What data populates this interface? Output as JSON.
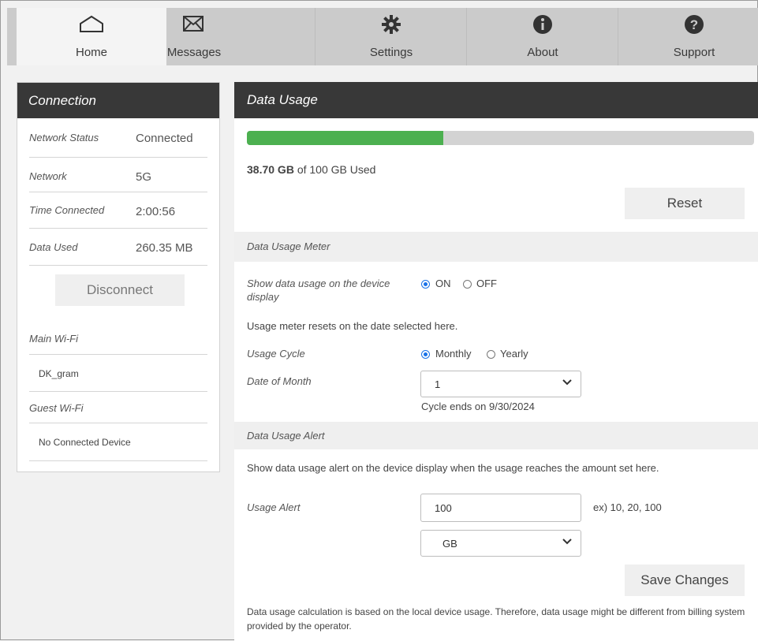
{
  "tabs": [
    {
      "label": "Home",
      "icon": "home-icon"
    },
    {
      "label": "Messages",
      "icon": "envelope-icon"
    },
    {
      "label": "Settings",
      "icon": "gear-icon"
    },
    {
      "label": "About",
      "icon": "info-icon"
    },
    {
      "label": "Support",
      "icon": "question-icon"
    }
  ],
  "connection": {
    "title": "Connection",
    "rows": [
      {
        "label": "Network Status",
        "value": "Connected"
      },
      {
        "label": "Network",
        "value": "5G"
      },
      {
        "label": "Time Connected",
        "value": "2:00:56"
      },
      {
        "label": "Data Used",
        "value": "260.35 MB"
      }
    ],
    "disconnect_label": "Disconnect",
    "main_wifi_label": "Main Wi-Fi",
    "main_wifi_device": "DK_gram",
    "guest_wifi_label": "Guest Wi-Fi",
    "guest_wifi_device": "No Connected Device"
  },
  "data_usage": {
    "title": "Data Usage",
    "used_value": "38.70 GB",
    "used_suffix": " of 100 GB Used",
    "usage_fraction": 0.387,
    "reset_label": "Reset",
    "meter_section": "Data Usage Meter",
    "show_on_device_label": "Show data usage on the device display",
    "on_label": "ON",
    "off_label": "OFF",
    "meter_selected": "ON",
    "reset_note": "Usage meter resets on the date selected here.",
    "usage_cycle_label": "Usage Cycle",
    "monthly_label": "Monthly",
    "yearly_label": "Yearly",
    "cycle_selected": "Monthly",
    "date_of_month_label": "Date of Month",
    "date_of_month_value": "1",
    "cycle_ends": "Cycle ends on 9/30/2024",
    "alert_section": "Data Usage Alert",
    "alert_note": "Show data usage alert on the device display when the usage reaches the amount set here.",
    "usage_alert_label": "Usage Alert",
    "usage_alert_value": "100",
    "usage_alert_hint": "ex) 10, 20, 100",
    "unit_value": "GB",
    "save_label": "Save Changes",
    "disclaimer": "Data usage calculation is based on the local device usage. Therefore, data usage might be different from billing system provided by the operator."
  },
  "colors": {
    "accent": "#4cb050",
    "header": "#383838",
    "radio": "#1a73e8"
  }
}
